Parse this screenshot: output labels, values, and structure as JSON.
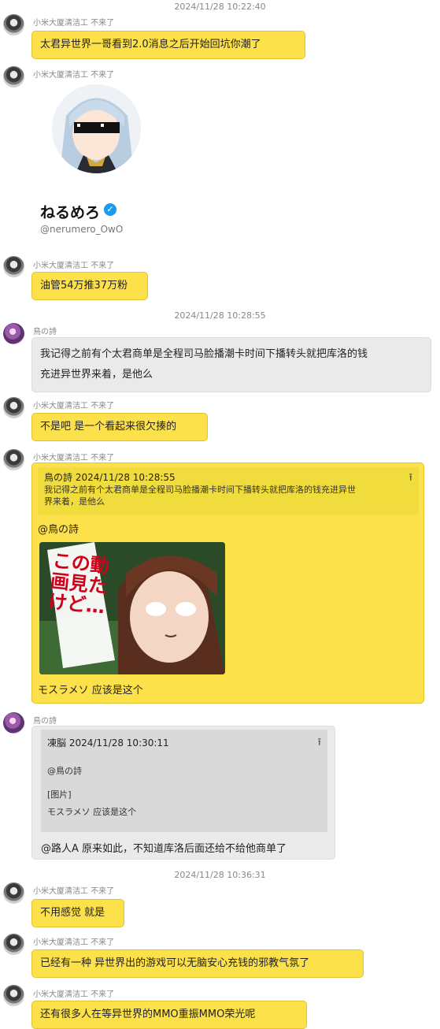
{
  "timestamps": [
    "2024/11/28 10:22:40",
    "2024/11/28 10:28:55",
    "2024/11/28 10:36:31"
  ],
  "sender_a": "小米大厦清洁工 不来了",
  "sender_b": "鳥の詩",
  "messages": {
    "m1": "太君异世界一哥看到2.0消息之后开始回坑你潮了",
    "card": {
      "name": "ねるめろ",
      "handle": "@nerumero_OwO",
      "verified_icon": "check-badge-icon"
    },
    "m3": "油管54万推37万粉",
    "m4_l1": "我记得之前有个太君商单是全程司马脸播潮卡时间下播转头就把库洛的钱",
    "m4_l2": "充进异世界来着，是他么",
    "m5": "不是吧 是一个看起来很欠揍的",
    "m6": {
      "quote_head": "鳥の詩  2024/11/28 10:28:55",
      "quote_l1": "我记得之前有个太君商单是全程司马脸播潮卡时间下播转头就把库洛的钱充进异世",
      "quote_l2": "界来着，是他么",
      "mention": "@鳥の詩",
      "image_text": "この動画見たけど…",
      "caption": "モスラメソ 应该是这个"
    },
    "m7": {
      "quote_head": "凍脳  2024/11/28 10:30:11",
      "quote_mention": "@鳥の詩",
      "quote_image": "[图片]",
      "quote_caption": "モスラメソ 应该是这个",
      "reply": "@路人A 原来如此，不知道库洛后面还给不给他商单了"
    },
    "m8": "不用感觉 就是",
    "m9": "已经有一种 异世界出的游戏可以无脑安心充钱的邪教气氛了",
    "m10": "还有很多人在等异世界的MMO重振MMO荣光呢"
  },
  "colors": {
    "bubble_yellow": "#fde14a",
    "bubble_gray": "#eaeaea",
    "timestamp": "#888888"
  }
}
